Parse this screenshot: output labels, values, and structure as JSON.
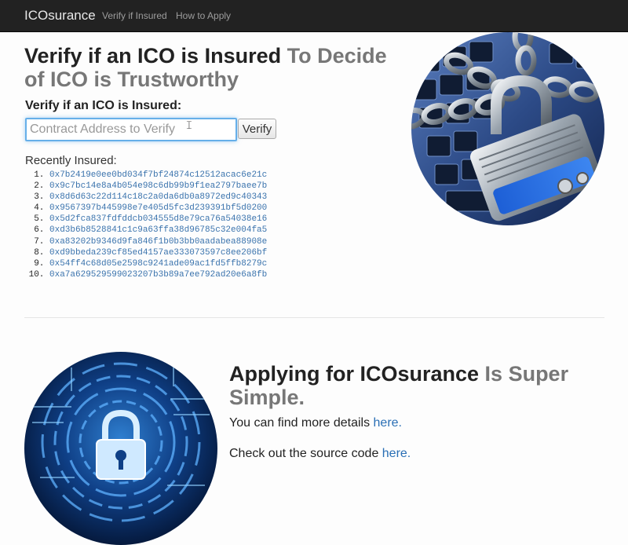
{
  "navbar": {
    "brand": "ICOsurance",
    "links": [
      "Verify if Insured",
      "How to Apply"
    ]
  },
  "hero": {
    "title_strong": "Verify if an ICO is Insured",
    "title_muted": " To Decide of ICO is Trustworthy",
    "verify_label": "Verify if an ICO is Insured:",
    "input_placeholder": "Contract Address to Verify",
    "input_value": "",
    "verify_button": "Verify",
    "recent_label": "Recently Insured:",
    "recent": [
      "0x7b2419e0ee0bd034f7bf24874c12512acac6e21c",
      "0x9c7bc14e8a4b054e98c6db99b9f1ea2797baee7b",
      "0x8d6d63c22d114c18c2a0da6db0a8972ed9c40343",
      "0x9567397b445998e7e405d5fc3d239391bf5d0200",
      "0x5d2fca837fdfddcb034555d8e79ca76a54038e16",
      "0xd3b6b8528841c1c9a63ffa38d96785c32e004fa5",
      "0xa83202b9346d9fa846f1b0b3bb0aadabea88908e",
      "0xd9bbeda239cf85ed4157ae333073597c8ee206bf",
      "0x54ff4c68d05e2598c9241ade09ac1fd5ffb8279c",
      "0xa7a629529599023207b3b89a7ee792ad20e6a8fb"
    ]
  },
  "apply": {
    "title_strong": "Applying for ICOsurance",
    "title_muted": " Is Super Simple.",
    "details_prefix": "You can find more details ",
    "details_link": "here.",
    "source_prefix": "Check out the source code ",
    "source_link": "here."
  },
  "icons": {
    "text_cursor": "text-cursor-icon",
    "lock_image": "chained-padlock-keyboard",
    "tech_image": "digital-padlock-circuit"
  },
  "colors": {
    "navbar_bg": "#222222",
    "link": "#2a6fb5",
    "muted": "#777777"
  }
}
